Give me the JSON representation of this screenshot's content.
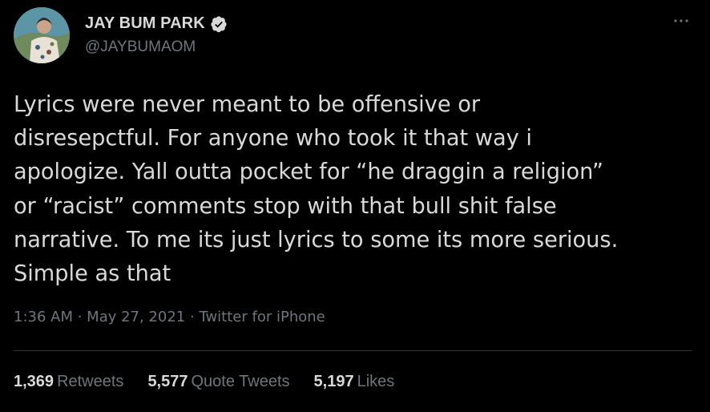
{
  "colors": {
    "background": "#000000",
    "primary_text": "#d9d9d9",
    "secondary_text": "#6e767d",
    "divider": "#2f3336"
  },
  "author": {
    "display_name": "JAY BUM PARK",
    "handle": "@JAYBUMAOM",
    "verified_icon": "verified-badge-icon",
    "avatar": "profile-avatar"
  },
  "menu": {
    "icon": "more-horizontal-icon"
  },
  "tweet": {
    "lines": [
      "Lyrics were never meant to be offensive or",
      "disresepctful. For anyone who took it that way i",
      "apologize. Yall outta pocket for “he draggin a religion”",
      "or “racist” comments stop with that bull shit false",
      "narrative. To me its just lyrics to some its more serious.",
      "Simple as that"
    ],
    "time": "1:36 AM",
    "date": "May 27, 2021",
    "source": "Twitter for iPhone",
    "separator": " · "
  },
  "stats": [
    {
      "count": "1,369",
      "label": "Retweets"
    },
    {
      "count": "5,577",
      "label": "Quote Tweets"
    },
    {
      "count": "5,197",
      "label": "Likes"
    }
  ]
}
